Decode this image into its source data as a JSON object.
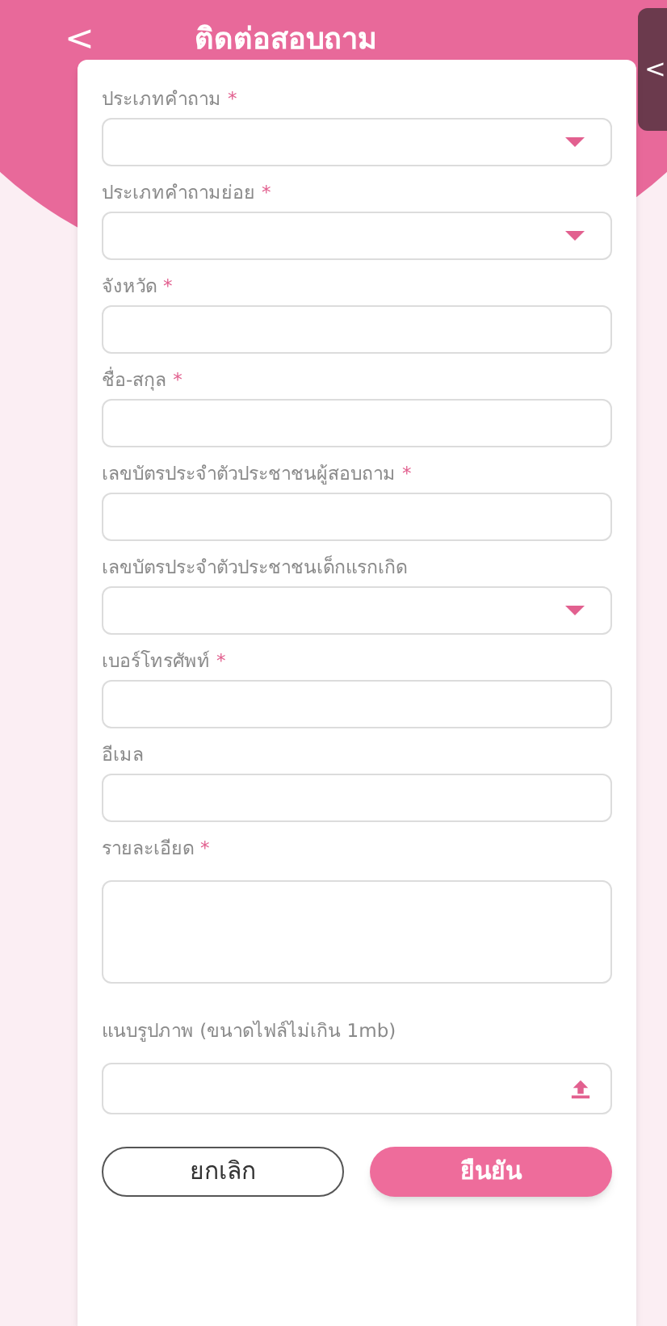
{
  "header": {
    "back": "<",
    "title": "ติดต่อสอบถาม",
    "side_tab": "<"
  },
  "fields": [
    {
      "kind": "select",
      "label": "ประเภทคำถาม",
      "mark": "*"
    },
    {
      "kind": "select",
      "label": "ประเภทคำถามย่อย",
      "mark": "*"
    },
    {
      "kind": "text",
      "label": "จังหวัด",
      "mark": "*"
    },
    {
      "kind": "text",
      "label": "ชื่อ-สกุล",
      "mark": "*"
    },
    {
      "kind": "text",
      "label": "เลขบัตรประจำตัวประชาชนผู้สอบถาม",
      "mark": "*"
    },
    {
      "kind": "select",
      "label": "เลขบัตรประจำตัวประชาชนเด็กแรกเกิด"
    },
    {
      "kind": "text",
      "label": "เบอร์โทรศัพท์",
      "mark": "*"
    },
    {
      "kind": "text",
      "label": "อีเมล"
    },
    {
      "kind": "textarea",
      "label": "รายละเอียด",
      "mark": "*"
    },
    {
      "kind": "file",
      "label": "แนบรูปภาพ (ขนาดไฟล์ไม่เกิน 1mb)"
    }
  ],
  "buttons": {
    "cancel": "ยกเลิก",
    "confirm": "ยืนยัน"
  }
}
